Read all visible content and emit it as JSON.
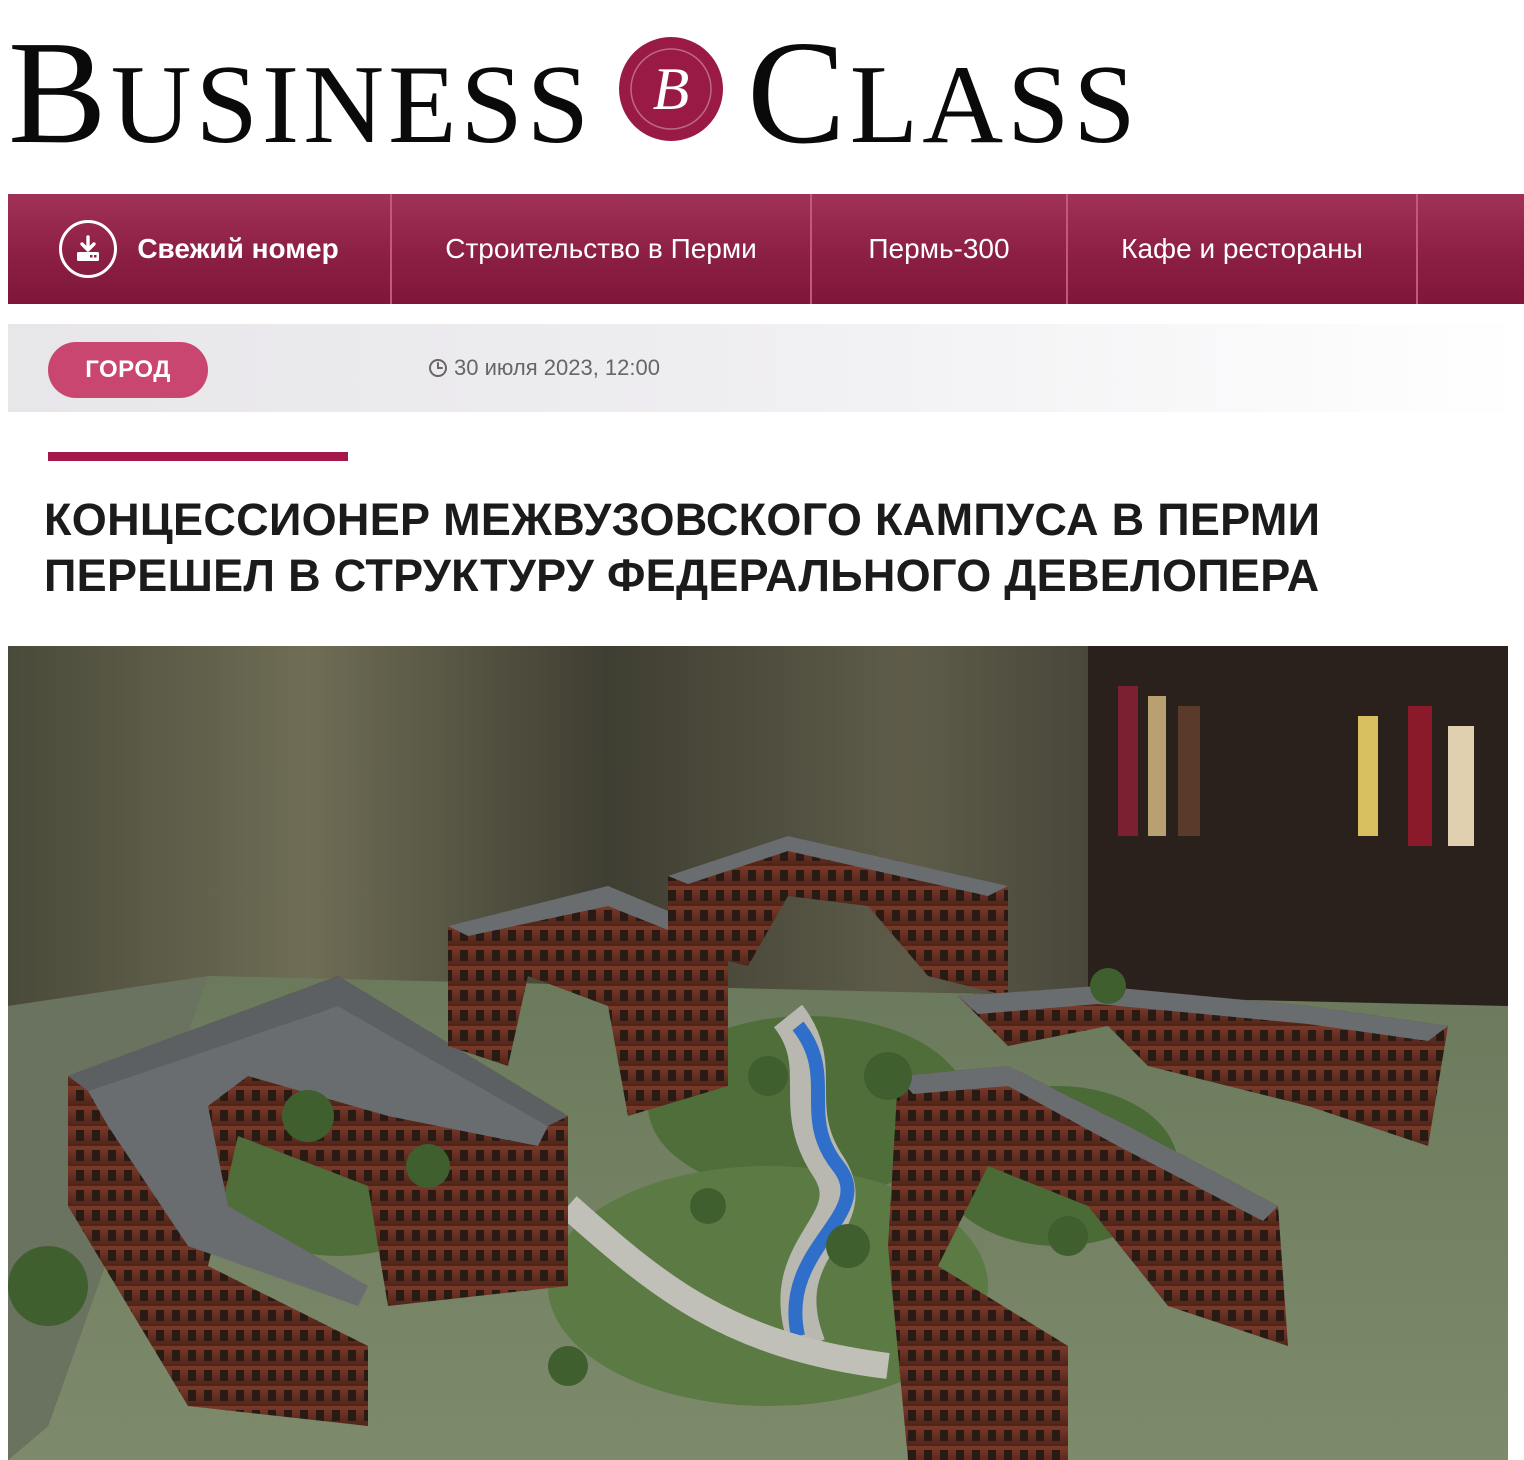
{
  "logo": {
    "word1_initial": "B",
    "word1_rest": "USINESS",
    "seal_letter": "B",
    "word2_initial": "C",
    "word2_rest": "LASS",
    "seal_color": "#9a1a46"
  },
  "nav": {
    "items": [
      {
        "label": "Свежий номер",
        "icon": "download-icon"
      },
      {
        "label": "Строительство в Перми"
      },
      {
        "label": "Пермь-300"
      },
      {
        "label": "Кафе и рестораны"
      },
      {
        "label": ""
      }
    ],
    "background": "#8c1f44"
  },
  "article": {
    "category": "ГОРОД",
    "date": "30 июля 2023, 12:00",
    "date_icon": "clock-icon",
    "title": "КОНЦЕССИОНЕР МЕЖВУЗОВСКОГО КАМПУСА В ПЕРМИ ПЕРЕШЕЛ В СТРУКТУРУ ФЕДЕРАЛЬНОГО ДЕВЕЛОПЕРА",
    "accent_color": "#a3174b",
    "tag_color": "#c94671"
  }
}
